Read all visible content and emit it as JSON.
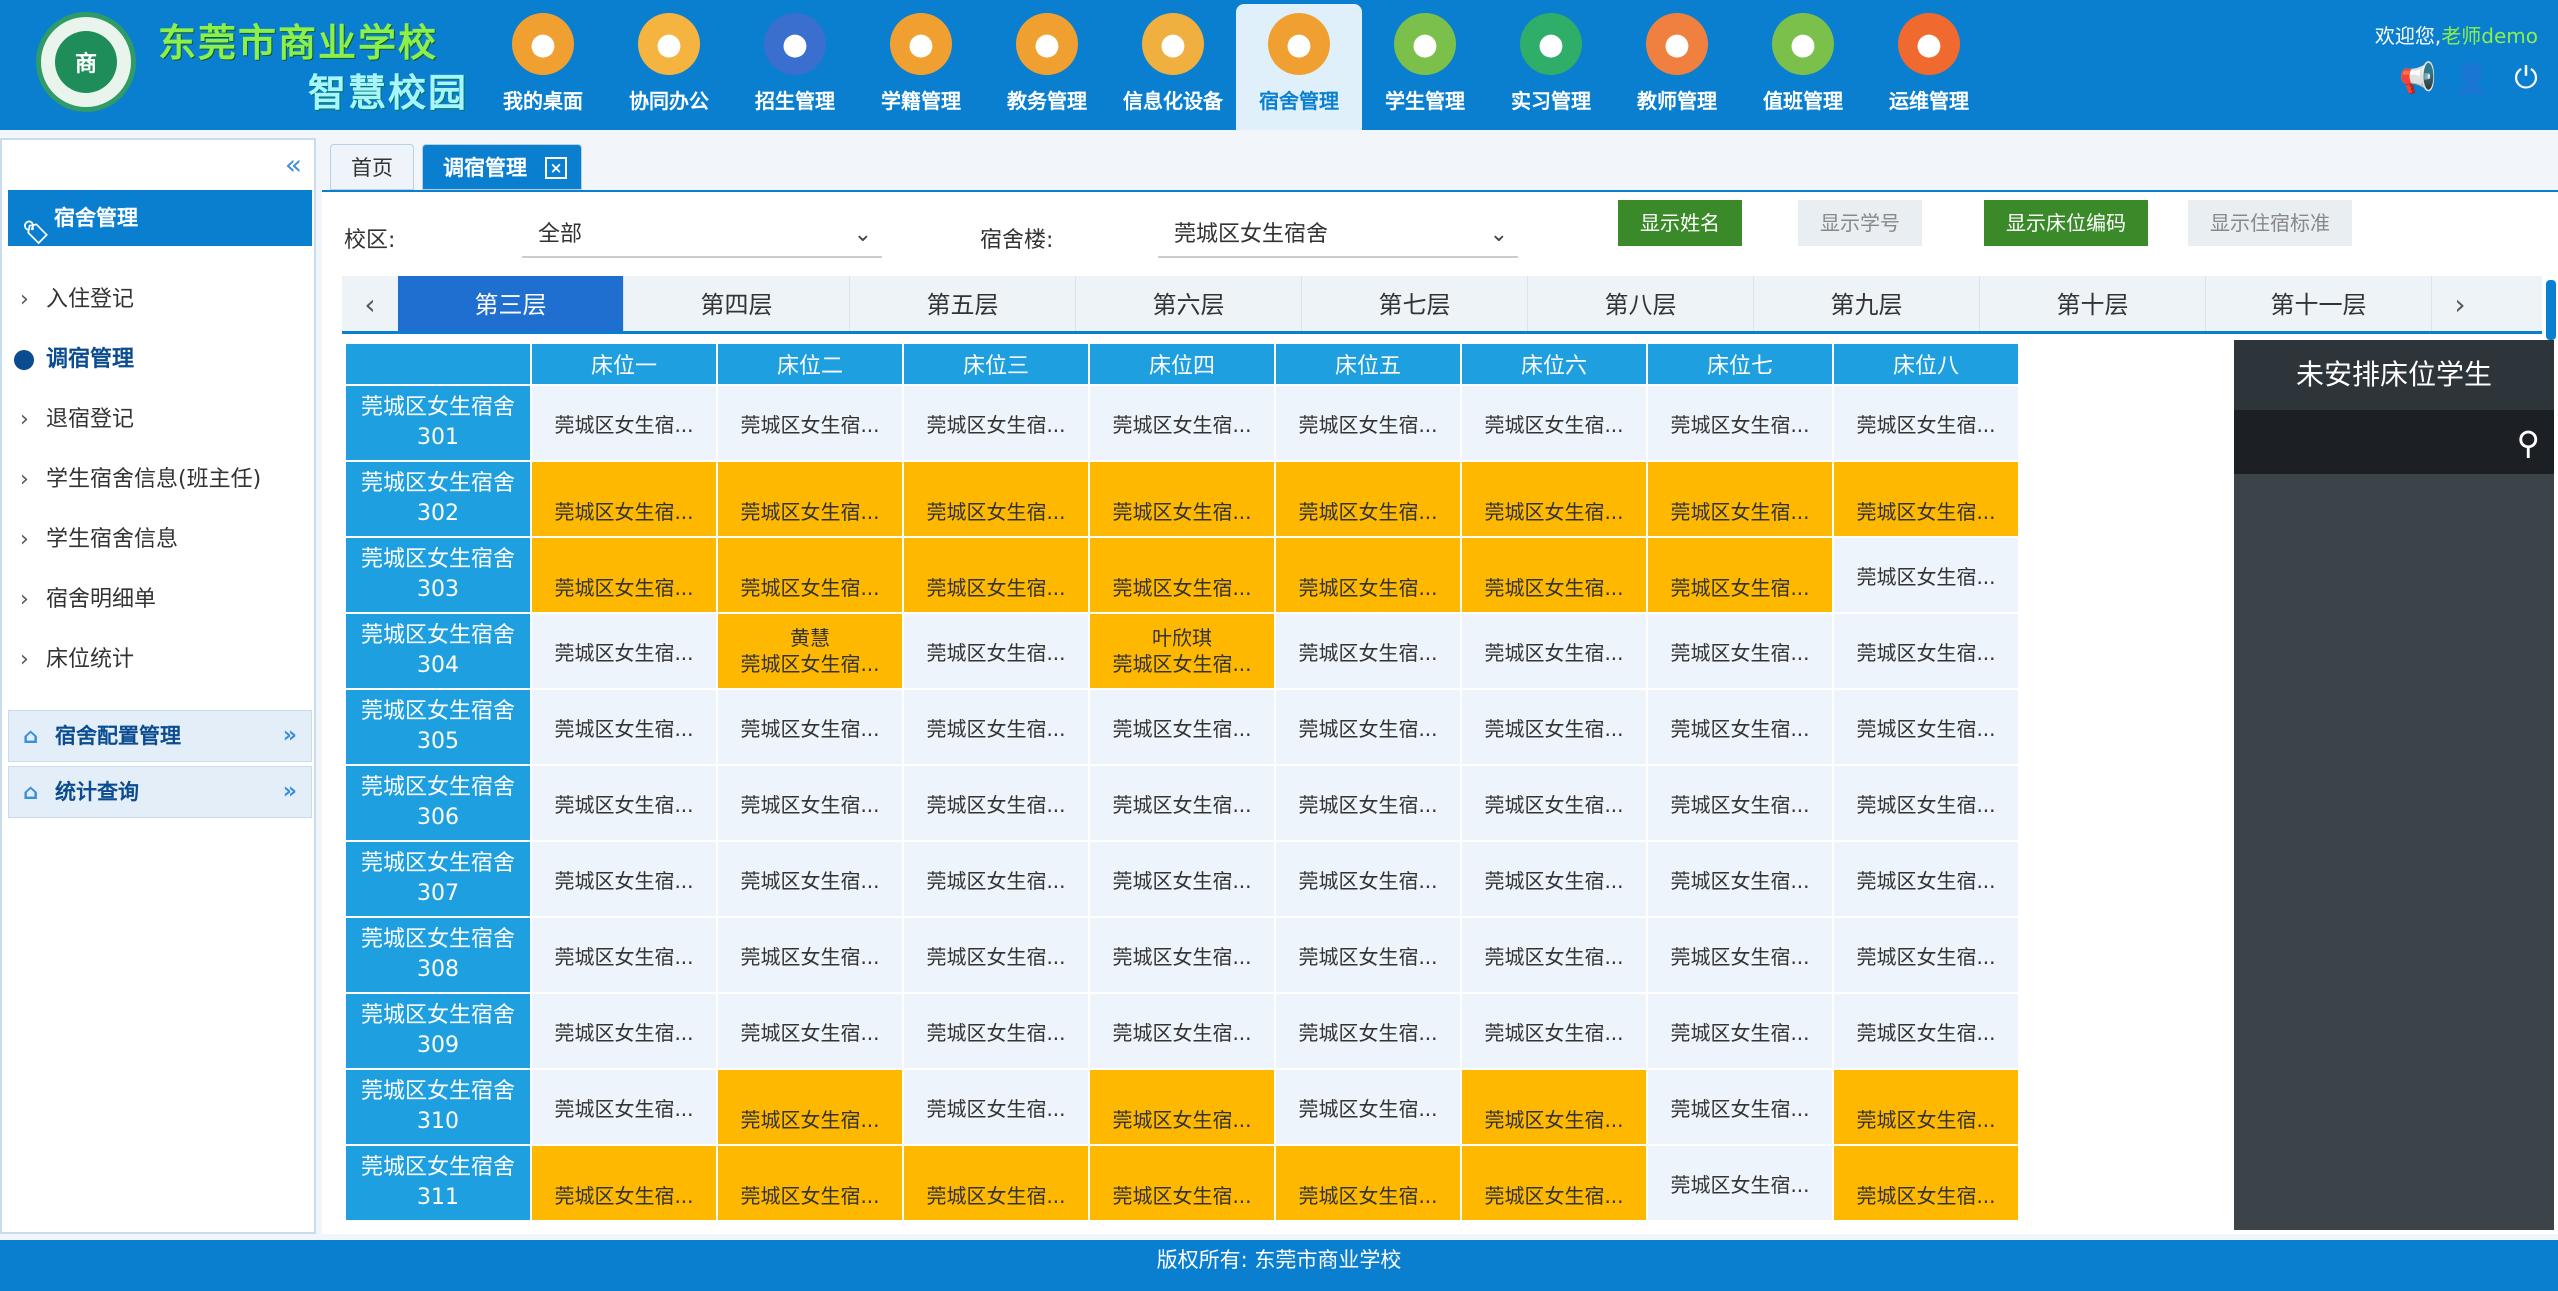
{
  "header": {
    "school_name": "东莞市商业学校",
    "campus_name": "智慧校园",
    "logo_text": "商",
    "welcome_prefix": "欢迎您,",
    "username": "老师demo"
  },
  "nav": [
    {
      "label": "我的桌面",
      "icon": "desktop-icon",
      "color": "#f0a030"
    },
    {
      "label": "协同办公",
      "icon": "office-icon",
      "color": "#f5b440"
    },
    {
      "label": "招生管理",
      "icon": "student-icon",
      "color": "#3a6fd0"
    },
    {
      "label": "学籍管理",
      "icon": "records-icon",
      "color": "#f0a030"
    },
    {
      "label": "教务管理",
      "icon": "teaching-icon",
      "color": "#f0a030"
    },
    {
      "label": "信息化设备",
      "icon": "device-icon",
      "color": "#f0b040"
    },
    {
      "label": "宿舍管理",
      "icon": "dorm-icon",
      "color": "#f0a030"
    },
    {
      "label": "学生管理",
      "icon": "student-manage-icon",
      "color": "#7bc04a"
    },
    {
      "label": "实习管理",
      "icon": "internship-icon",
      "color": "#2fae6a"
    },
    {
      "label": "教师管理",
      "icon": "teacher-icon",
      "color": "#f08040"
    },
    {
      "label": "值班管理",
      "icon": "duty-icon",
      "color": "#7bc04a"
    },
    {
      "label": "运维管理",
      "icon": "ops-icon",
      "color": "#f06a30"
    }
  ],
  "nav_active": 6,
  "sidebar": {
    "title": "宿舍管理",
    "items": [
      {
        "label": "入住登记"
      },
      {
        "label": "调宿管理"
      },
      {
        "label": "退宿登记"
      },
      {
        "label": "学生宿舍信息(班主任)"
      },
      {
        "label": "学生宿舍信息"
      },
      {
        "label": "宿舍明细单"
      },
      {
        "label": "床位统计"
      }
    ],
    "groups": [
      {
        "label": "宿舍配置管理"
      },
      {
        "label": "统计查询"
      }
    ]
  },
  "tabs": [
    {
      "label": "首页"
    },
    {
      "label": "调宿管理"
    }
  ],
  "filters": {
    "campus_label": "校区:",
    "campus_value": "全部",
    "building_label": "宿舍楼:",
    "building_value": "莞城区女生宿舍"
  },
  "toggles": [
    {
      "label": "显示姓名",
      "on": true
    },
    {
      "label": "显示学号",
      "on": false
    },
    {
      "label": "显示床位编码",
      "on": true
    },
    {
      "label": "显示住宿标准",
      "on": false
    }
  ],
  "floors": [
    "第三层",
    "第四层",
    "第五层",
    "第六层",
    "第七层",
    "第八层",
    "第九层",
    "第十层",
    "第十一层"
  ],
  "beds": [
    "床位一",
    "床位二",
    "床位三",
    "床位四",
    "床位五",
    "床位六",
    "床位七",
    "床位八"
  ],
  "cell_text": "莞城区女生宿...",
  "rooms": [
    {
      "name": "莞城区女生宿舍",
      "num": "301",
      "occ": [
        0,
        0,
        0,
        0,
        0,
        0,
        0,
        0
      ],
      "names": [
        "",
        "",
        "",
        "",
        "",
        "",
        "",
        ""
      ]
    },
    {
      "name": "莞城区女生宿舍",
      "num": "302",
      "occ": [
        1,
        1,
        1,
        1,
        1,
        1,
        1,
        1
      ],
      "names": [
        "",
        "",
        "",
        "",
        "",
        "",
        "",
        ""
      ]
    },
    {
      "name": "莞城区女生宿舍",
      "num": "303",
      "occ": [
        1,
        1,
        1,
        1,
        1,
        1,
        1,
        0
      ],
      "names": [
        "",
        "",
        "",
        "",
        "",
        "",
        "",
        ""
      ]
    },
    {
      "name": "莞城区女生宿舍",
      "num": "304",
      "occ": [
        0,
        1,
        0,
        1,
        0,
        0,
        0,
        0
      ],
      "names": [
        "",
        "黄慧",
        "",
        "叶欣琪",
        "",
        "",
        "",
        ""
      ]
    },
    {
      "name": "莞城区女生宿舍",
      "num": "305",
      "occ": [
        0,
        0,
        0,
        0,
        0,
        0,
        0,
        0
      ],
      "names": [
        "",
        "",
        "",
        "",
        "",
        "",
        "",
        ""
      ]
    },
    {
      "name": "莞城区女生宿舍",
      "num": "306",
      "occ": [
        0,
        0,
        0,
        0,
        0,
        0,
        0,
        0
      ],
      "names": [
        "",
        "",
        "",
        "",
        "",
        "",
        "",
        ""
      ]
    },
    {
      "name": "莞城区女生宿舍",
      "num": "307",
      "occ": [
        0,
        0,
        0,
        0,
        0,
        0,
        0,
        0
      ],
      "names": [
        "",
        "",
        "",
        "",
        "",
        "",
        "",
        ""
      ]
    },
    {
      "name": "莞城区女生宿舍",
      "num": "308",
      "occ": [
        0,
        0,
        0,
        0,
        0,
        0,
        0,
        0
      ],
      "names": [
        "",
        "",
        "",
        "",
        "",
        "",
        "",
        ""
      ]
    },
    {
      "name": "莞城区女生宿舍",
      "num": "309",
      "occ": [
        0,
        0,
        0,
        0,
        0,
        0,
        0,
        0
      ],
      "names": [
        "",
        "",
        "",
        "",
        "",
        "",
        "",
        ""
      ]
    },
    {
      "name": "莞城区女生宿舍",
      "num": "310",
      "occ": [
        0,
        1,
        0,
        1,
        0,
        1,
        0,
        1
      ],
      "names": [
        "",
        "",
        "",
        "",
        "",
        "",
        "",
        ""
      ]
    },
    {
      "name": "莞城区女生宿舍",
      "num": "311",
      "occ": [
        1,
        1,
        1,
        1,
        1,
        1,
        0,
        1
      ],
      "names": [
        "",
        "",
        "",
        "",
        "",
        "",
        "",
        ""
      ]
    }
  ],
  "unassigned": {
    "title": "未安排床位学生"
  },
  "footer": {
    "text": "版权所有: 东莞市商业学校"
  },
  "colors": {
    "primary": "#0a7fd0",
    "occupied": "#ffb800",
    "toggle_on": "#3a8a2a"
  }
}
